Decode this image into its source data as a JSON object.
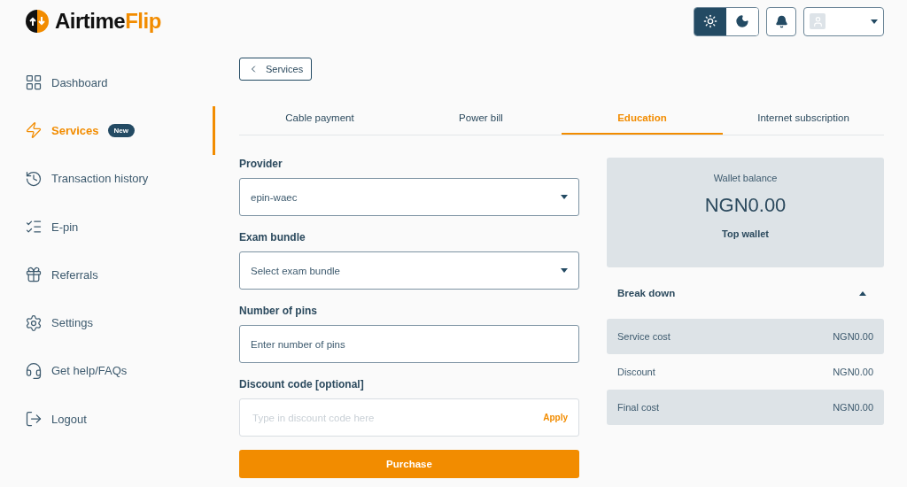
{
  "logo": {
    "first": "Airtime",
    "second": "Flip"
  },
  "theme_toggle": [
    {
      "kind": "sun",
      "selected": true
    },
    {
      "kind": "moon",
      "selected": false
    }
  ],
  "sidebar": {
    "items": [
      {
        "kind": "dashboard",
        "label": "Dashboard",
        "selected": false
      },
      {
        "kind": "services",
        "label": "Services",
        "selected": true,
        "badge": "New"
      },
      {
        "kind": "history",
        "label": "Transaction history",
        "selected": false
      },
      {
        "kind": "epin",
        "label": "E-pin",
        "selected": false
      },
      {
        "kind": "gift",
        "label": "Referrals",
        "selected": false
      },
      {
        "kind": "settings",
        "label": "Settings",
        "selected": false
      },
      {
        "kind": "help",
        "label": "Get help/FAQs",
        "selected": false
      },
      {
        "kind": "logout",
        "label": "Logout",
        "selected": false
      }
    ]
  },
  "back_button": "Services",
  "tabs": [
    {
      "label": "Cable payment",
      "selected": false
    },
    {
      "label": "Power bill",
      "selected": false
    },
    {
      "label": "Education",
      "selected": true
    },
    {
      "label": "Internet subscription",
      "selected": false
    }
  ],
  "form": {
    "fields": [
      {
        "kind": "select",
        "label": "Provider",
        "value": "epin-waec"
      },
      {
        "kind": "select",
        "label": "Exam bundle",
        "value": "Select exam bundle"
      },
      {
        "kind": "input",
        "label": "Number of pins",
        "placeholder": "Enter number of pins"
      },
      {
        "kind": "discount",
        "label": "Discount code [optional]",
        "placeholder": "Type in discount code here",
        "action": "Apply"
      }
    ],
    "submit": "Purchase"
  },
  "wallet": {
    "title": "Wallet balance",
    "amount": "NGN0.00",
    "action": "Top wallet"
  },
  "breakdown": {
    "title": "Break down",
    "expanded": true,
    "rows": [
      {
        "label": "Service cost",
        "value": "NGN0.00",
        "shaded": true
      },
      {
        "label": "Discount",
        "value": "NGN0.00",
        "shaded": false
      },
      {
        "label": "Final cost",
        "value": "NGN0.00",
        "shaded": true
      }
    ]
  }
}
